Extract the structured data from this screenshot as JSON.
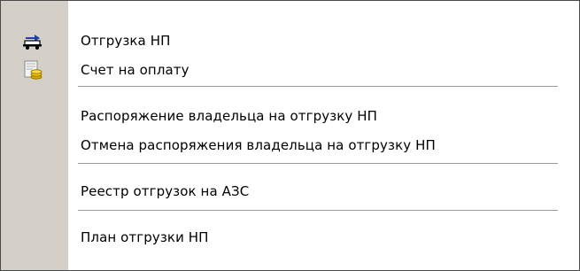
{
  "menu": {
    "items": [
      {
        "label": "Отгрузка НП",
        "icon": "fuel-truck-icon"
      },
      {
        "label": "Счет на оплату",
        "icon": "invoice-coins-icon"
      },
      {
        "label": "Распоряжение владельца на отгрузку НП"
      },
      {
        "label": "Отмена распоряжения владельца на отгрузку НП"
      },
      {
        "label": "Реестр отгрузок на АЗС"
      },
      {
        "label": "План отгрузки НП"
      }
    ]
  },
  "colors": {
    "gutter": "#d4d0c8",
    "border": "#4a4a4a",
    "separator": "#9a9a9a"
  }
}
